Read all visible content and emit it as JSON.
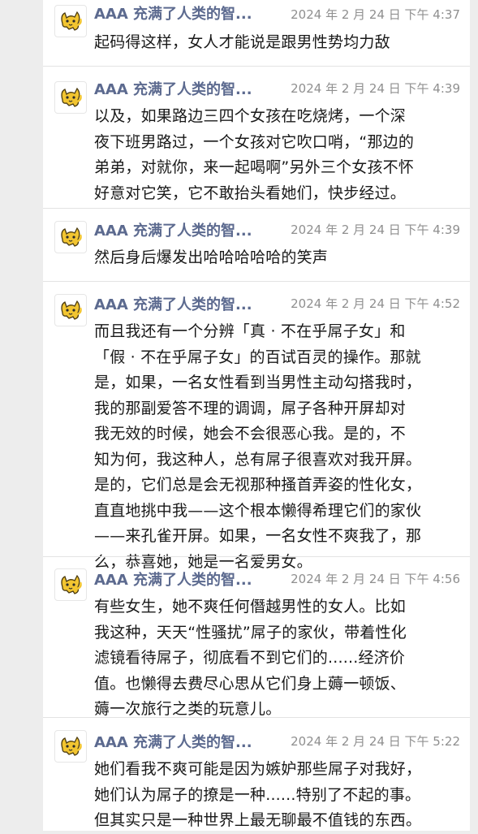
{
  "messages": [
    {
      "name": "AAA 充满了人类的智...",
      "time": "2024 年 2 月 24 日 下午 4:37",
      "text": "起码得这样，女人才能说是跟男性势均力敌"
    },
    {
      "name": "AAA 充满了人类的智...",
      "time": "2024 年 2 月 24 日 下午 4:39",
      "text": "以及，如果路边三四个女孩在吃烧烤，一个深\n夜下班男路过，一个女孩对它吹口哨，“那边的\n弟弟，对就你，来一起喝啊”另外三个女孩不怀\n好意对它笑，它不敢抬头看她们，快步经过。"
    },
    {
      "name": "AAA 充满了人类的智...",
      "time": "2024 年 2 月 24 日 下午 4:39",
      "text": "然后身后爆发出哈哈哈哈哈的笑声"
    },
    {
      "name": "AAA 充满了人类的智...",
      "time": "2024 年 2 月 24 日 下午 4:52",
      "text": "而且我还有一个分辨「真 · 不在乎屌子女」和\n「假 · 不在乎屌子女」的百试百灵的操作。那就\n是，如果，一名女性看到当男性主动勾搭我时，\n我的那副爱答不理的调调，屌子各种开屏却对\n我无效的时候，她会不会很恶心我。是的，不\n知为何，我这种人，总有屌子很喜欢对我开屏。\n是的，它们总是会无视那种搔首弄姿的性化女，\n直直地挑中我——这个根本懒得希理它们的家伙\n——来孔雀开屏。如果，一名女性不爽我了，那\n么，恭喜她，她是一名爱男女。"
    },
    {
      "name": "AAA 充满了人类的智...",
      "time": "2024 年 2 月 24 日 下午 4:56",
      "text": "有些女生，她不爽任何僭越男性的女人。比如\n我这种，天天“性骚扰”屌子的家伙，带着性化\n滤镜看待屌子，彻底看不到它们的......经济价\n值。也懒得去费尽心思从它们身上薅一顿饭、\n薅一次旅行之类的玩意儿。"
    },
    {
      "name": "AAA 充满了人类的智...",
      "time": "2024 年 2 月 24 日 下午 5:22",
      "text": "她们看我不爽可能是因为嫉妒那些屌子对我好，\n她们认为屌子的撩是一种......特别了不起的事。\n但其实只是一种世界上最无聊最不值钱的东西。"
    }
  ]
}
